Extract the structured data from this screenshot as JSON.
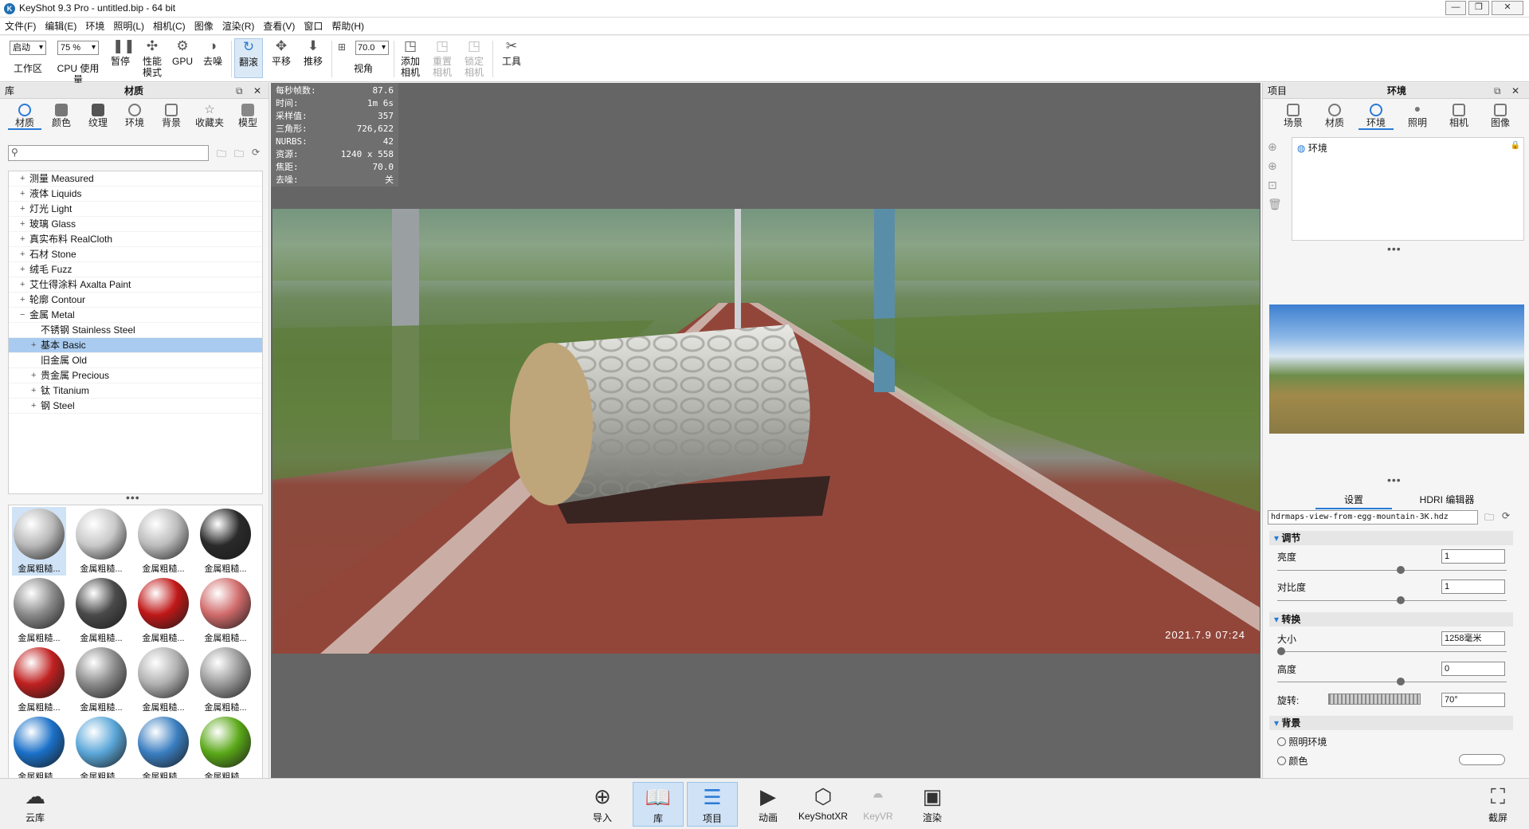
{
  "window": {
    "title": "KeyShot 9.3 Pro  - untitled.bip  - 64 bit"
  },
  "menu": [
    "文件(F)",
    "编辑(E)",
    "环境",
    "照明(L)",
    "相机(C)",
    "图像",
    "渲染(R)",
    "查看(V)",
    "窗口",
    "帮助(H)"
  ],
  "toolbar": {
    "workspace_select": "启动",
    "workspace_label": "工作区",
    "cpu_select": "75 %",
    "cpu_label": "CPU 使用量",
    "pause": "暂停",
    "perf_mode": "性能\n模式",
    "gpu": "GPU",
    "denoise": "去噪",
    "tumble": "翻滚",
    "pan": "平移",
    "dolly": "推移",
    "fov_value": "70.0",
    "fov_label": "视角",
    "add_camera": "添加\n相机",
    "reset_camera": "重置\n相机",
    "lock_camera": "锁定\n相机",
    "tools": "工具"
  },
  "library": {
    "header_left": "库",
    "header_title": "材质",
    "tabs": [
      "材质",
      "颜色",
      "纹理",
      "环境",
      "背景",
      "收藏夹",
      "模型"
    ],
    "tree": [
      {
        "label": "测量 Measured",
        "exp": "+",
        "level": 0
      },
      {
        "label": "液体 Liquids",
        "exp": "+",
        "level": 0
      },
      {
        "label": "灯光 Light",
        "exp": "+",
        "level": 0
      },
      {
        "label": "玻璃 Glass",
        "exp": "+",
        "level": 0
      },
      {
        "label": "真实布料 RealCloth",
        "exp": "+",
        "level": 0
      },
      {
        "label": "石材 Stone",
        "exp": "+",
        "level": 0
      },
      {
        "label": "绒毛 Fuzz",
        "exp": "+",
        "level": 0
      },
      {
        "label": "艾仕得涂料 Axalta Paint",
        "exp": "+",
        "level": 0
      },
      {
        "label": "轮廓 Contour",
        "exp": "+",
        "level": 0
      },
      {
        "label": "金属 Metal",
        "exp": "−",
        "level": 0
      },
      {
        "label": "不锈钢 Stainless Steel",
        "exp": "",
        "level": 1
      },
      {
        "label": "基本 Basic",
        "exp": "+",
        "level": 1,
        "selected": true
      },
      {
        "label": "旧金属 Old",
        "exp": "",
        "level": 1
      },
      {
        "label": "贵金属 Precious",
        "exp": "+",
        "level": 1
      },
      {
        "label": "钛 Titanium",
        "exp": "+",
        "level": 1
      },
      {
        "label": "钢 Steel",
        "exp": "+",
        "level": 1
      }
    ],
    "thumb_label": "金属粗糙...",
    "thumb_colors": [
      "#b8b8b8",
      "#c8c8c8",
      "#bcbcbc",
      "#2a2a2a",
      "#8a8a8a",
      "#4a4a4a",
      "#c01818",
      "#d06a6a",
      "#c02020",
      "#8a8a8a",
      "#b0b0b0",
      "#9a9a9a",
      "#1a70c8",
      "#5aa6d8",
      "#3a7ec0",
      "#5aa818",
      "#6ab048",
      "#58a830",
      "#b8b8b8",
      "#c4c4c4"
    ]
  },
  "stats": [
    {
      "k": "每秒帧数:",
      "v": "87.6"
    },
    {
      "k": "时间:",
      "v": "1m 6s"
    },
    {
      "k": "采样值:",
      "v": "357"
    },
    {
      "k": "三角形:",
      "v": "726,622"
    },
    {
      "k": "NURBS:",
      "v": "42"
    },
    {
      "k": "资源:",
      "v": "1240 x 558"
    },
    {
      "k": "焦距:",
      "v": "70.0"
    },
    {
      "k": "去噪:",
      "v": "关"
    }
  ],
  "scene": {
    "timestamp": "2021.7.9 07:24"
  },
  "project": {
    "header_left": "项目",
    "header_title": "环境",
    "tabs": [
      "场景",
      "材质",
      "环境",
      "照明",
      "相机",
      "图像"
    ],
    "env_item": "环境",
    "subtabs": [
      "设置",
      "HDRI 编辑器"
    ],
    "hdri_file": "hdrmaps-view-from-egg-mountain-3K.hdz",
    "sections": {
      "adjust": "调节",
      "transform": "转换",
      "background": "背景"
    },
    "props": {
      "brightness_label": "亮度",
      "brightness": "1",
      "contrast_label": "对比度",
      "contrast": "1",
      "size_label": "大小",
      "size": "1258毫米",
      "height_label": "高度",
      "height": "0",
      "rotation_label": "旋转:",
      "rotation": "70°"
    },
    "bg_options": [
      "照明环境",
      "颜色"
    ]
  },
  "bottom": {
    "cloud": "云库",
    "import": "导入",
    "library": "库",
    "project": "项目",
    "animation": "动画",
    "keyshotxr": "KeyShotXR",
    "keyvr": "KeyVR",
    "render": "渲染",
    "screenshot": "截屏"
  },
  "colors": {
    "accent": "#2a7ad6",
    "selected_row": "#a9cbf0",
    "viewport_bg": "#656565"
  }
}
